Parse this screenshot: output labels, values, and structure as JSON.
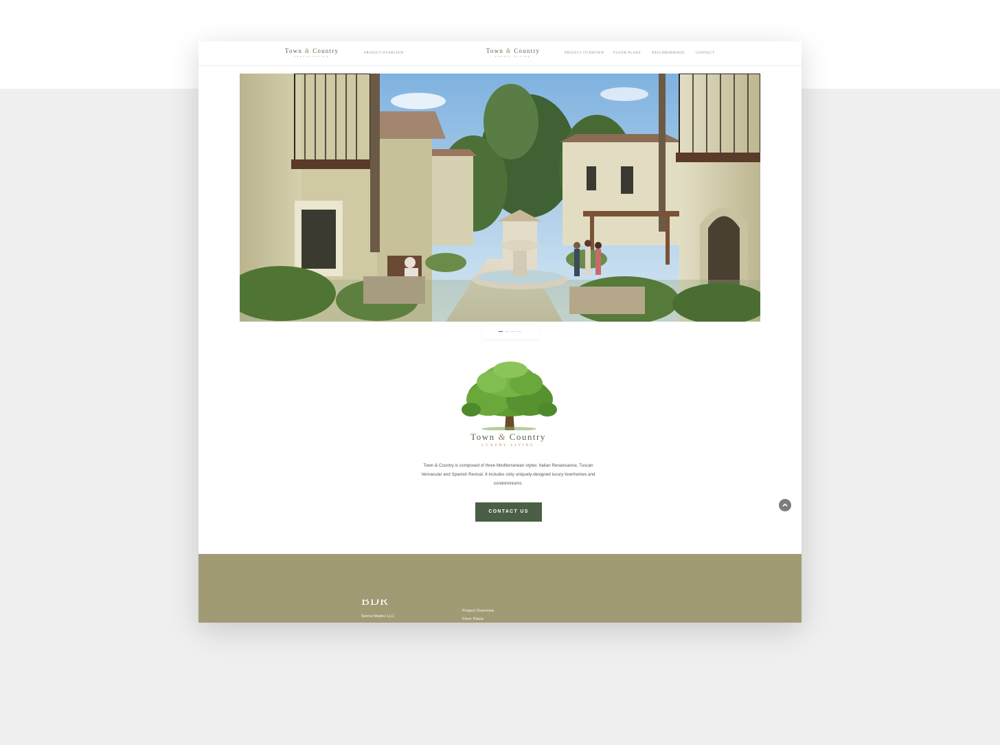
{
  "header": {
    "left_logo": {
      "title_a": "Town",
      "amp": "&",
      "title_b": "Country",
      "subtitle": "· Luxury Living ·"
    },
    "left_nav": [
      "Project Overview"
    ],
    "main_logo": {
      "title_a": "Town",
      "amp": "&",
      "title_b": "Country",
      "subtitle": "· Luxury Living ·"
    },
    "nav": [
      "Project Overview",
      "Floor Plans",
      "Neighborhood",
      "Contact"
    ]
  },
  "hero": {
    "slides": 4,
    "active_slide": 1
  },
  "brand": {
    "icon": "oak-tree-logo",
    "title_a": "Town",
    "amp": "&",
    "title_b": "Country",
    "subtitle": "· LUXURY LIVING ·",
    "description": "Town & Country is composed of three Mediterranean styles: Italian Renaissance, Tuscan Vernacular and Spanish Revival. It includes sixty uniquely-designed luxury townhomes and condominiums."
  },
  "cta": {
    "label": "CONTACT US"
  },
  "scroll_top": {
    "icon": "chevron-up-icon"
  },
  "footer": {
    "brand": "BDR",
    "company": "Sierra Madre LLC",
    "links": [
      "Project Overview",
      "Floor Plans"
    ]
  },
  "colors": {
    "accent_green": "#4a5f45",
    "footer_olive": "#a09b75",
    "page_bg": "#efefef"
  }
}
